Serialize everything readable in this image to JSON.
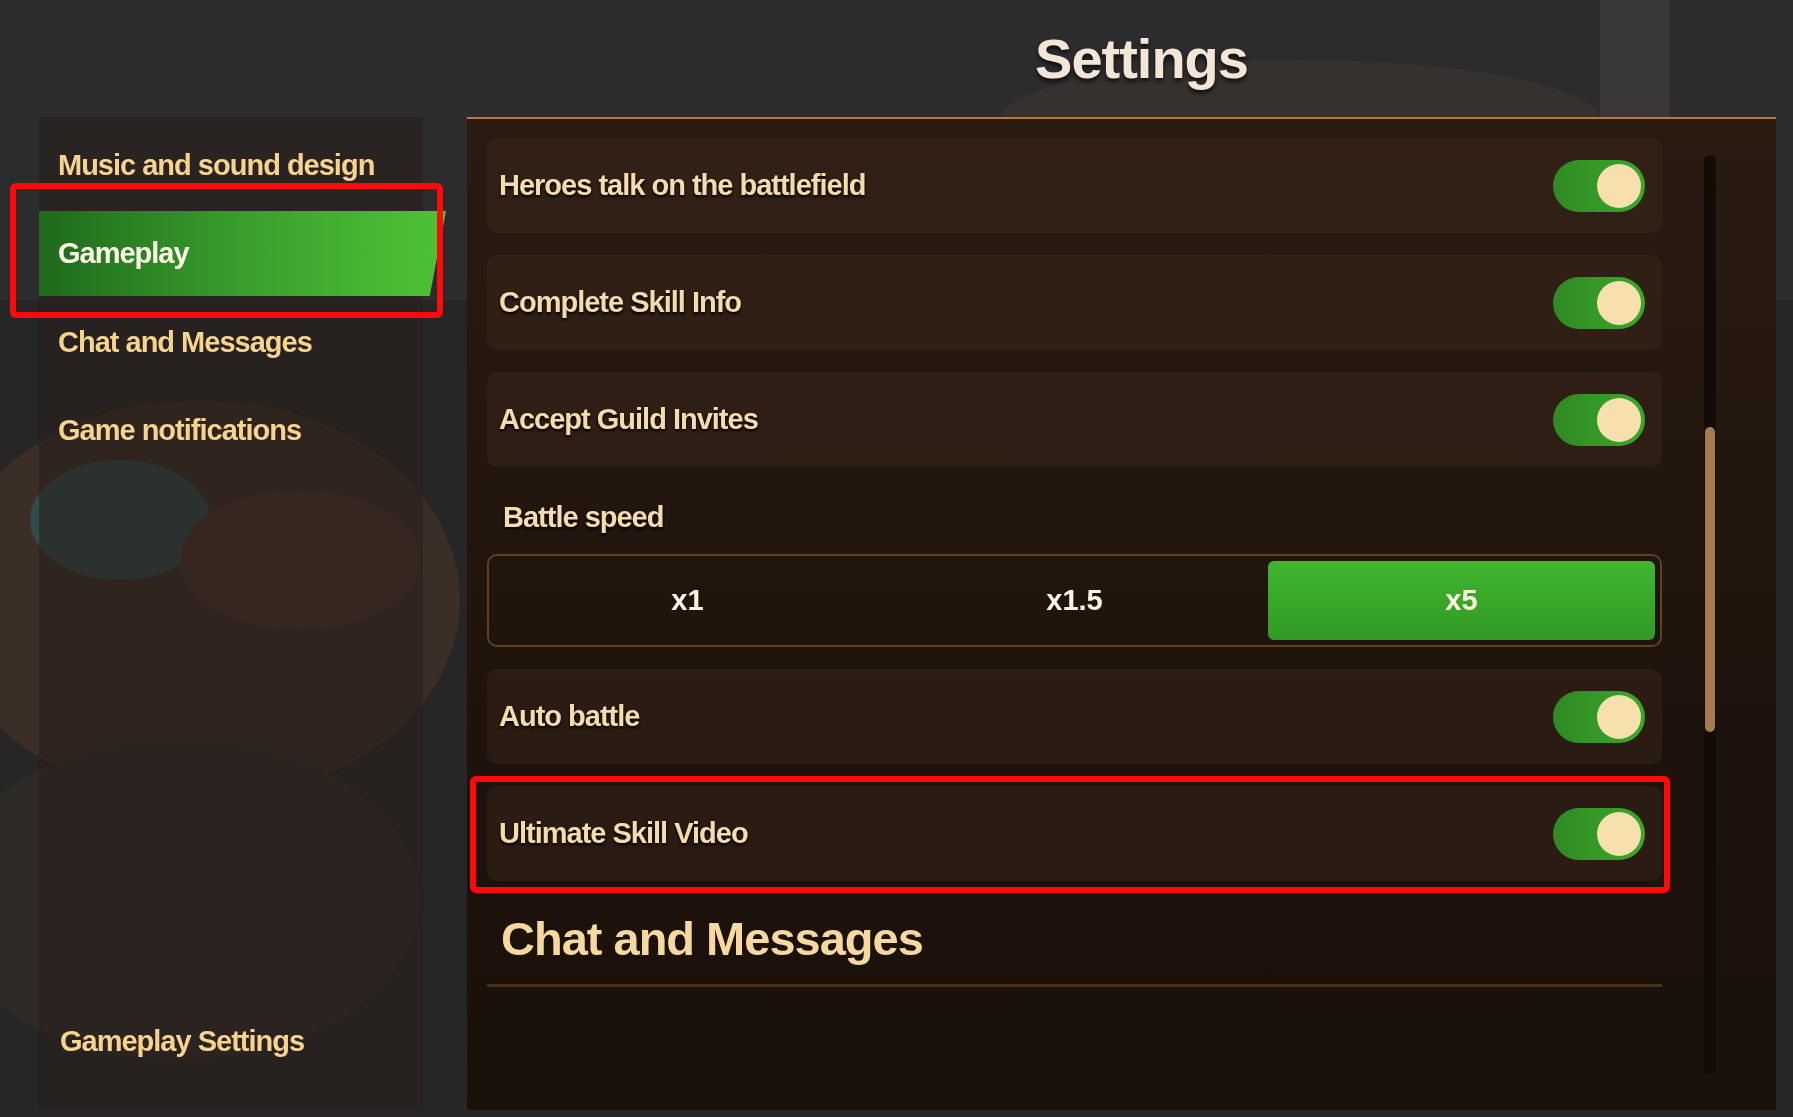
{
  "title": "Settings",
  "sidebar": {
    "items": [
      {
        "label": "Music and sound design",
        "selected": false,
        "highlighted": false
      },
      {
        "label": "Gameplay",
        "selected": true,
        "highlighted": true
      },
      {
        "label": "Chat and Messages",
        "selected": false,
        "highlighted": false
      },
      {
        "label": "Game notifications",
        "selected": false,
        "highlighted": false
      }
    ],
    "footer": "Gameplay Settings"
  },
  "settings": [
    {
      "kind": "toggle",
      "label": "Heroes talk on the battlefield",
      "on": true,
      "highlighted": false
    },
    {
      "kind": "toggle",
      "label": "Complete Skill Info",
      "on": true,
      "highlighted": false
    },
    {
      "kind": "toggle",
      "label": "Accept Guild Invites",
      "on": true,
      "highlighted": false
    },
    {
      "kind": "segmented",
      "label": "Battle speed",
      "options": [
        {
          "label": "x1",
          "selected": false
        },
        {
          "label": "x1.5",
          "selected": false
        },
        {
          "label": "x5",
          "selected": true
        }
      ]
    },
    {
      "kind": "toggle",
      "label": "Auto battle",
      "on": true,
      "highlighted": false
    },
    {
      "kind": "toggle",
      "label": "Ultimate Skill Video",
      "on": true,
      "highlighted": true
    }
  ],
  "section_heading": "Chat and Messages"
}
